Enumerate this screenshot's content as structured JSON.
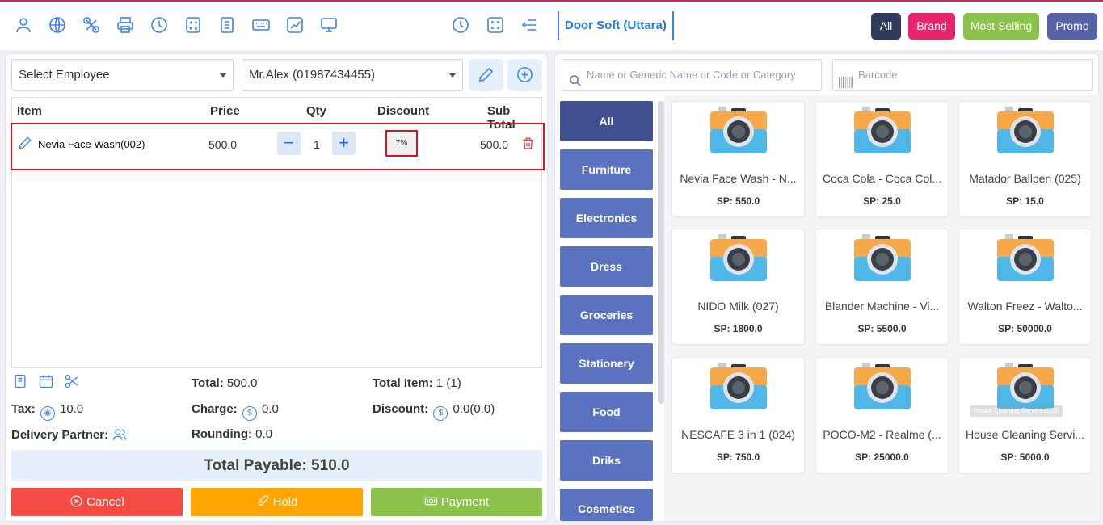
{
  "header": {
    "store_name": "Door Soft (Uttara)",
    "icons": [
      "user-icon",
      "globe-icon",
      "pos-icon",
      "printer-icon",
      "history-icon",
      "calculator-icon",
      "register-icon",
      "keyboard-icon",
      "chart-icon",
      "monitor-icon",
      "clock-icon",
      "fullscreen-icon",
      "menu-collapse-icon"
    ],
    "filters": [
      {
        "label": "All",
        "color": "#2f3a5c"
      },
      {
        "label": "Brand",
        "color": "#e8246a"
      },
      {
        "label": "Most Selling",
        "color": "#8bc34a"
      },
      {
        "label": "Promo",
        "color": "#5663a8"
      }
    ]
  },
  "cart": {
    "employee_select": "Select Employee",
    "customer_select": "Mr.Alex (01987434455)",
    "columns": {
      "item": "Item",
      "price": "Price",
      "qty": "Qty",
      "discount": "Discount",
      "subtotal": "Sub Total"
    },
    "row": {
      "name": "Nevia Face Wash(002)",
      "price": "500.0",
      "qty": "1",
      "discount": "7%",
      "subtotal": "500.0"
    }
  },
  "summary": {
    "total_label": "Total:",
    "total": "500.0",
    "total_item_label": "Total Item:",
    "total_item": "1 (1)",
    "tax_label": "Tax:",
    "tax": "10.0",
    "charge_label": "Charge:",
    "charge": "0.0",
    "discount_label": "Discount:",
    "discount": "0.0(0.0)",
    "delivery_label": "Delivery Partner:",
    "rounding_label": "Rounding:",
    "rounding": "0.0",
    "payable": "Total Payable: 510.0"
  },
  "actions": {
    "cancel": "Cancel",
    "hold": "Hold",
    "payment": "Payment",
    "colors": {
      "cancel": "#f44c43",
      "hold": "#ffa500",
      "payment": "#8bc34a"
    }
  },
  "products_panel": {
    "search_placeholder": "Name or Generic Name or Code or Category",
    "barcode_placeholder": "Barcode",
    "categories": [
      "All",
      "Furniture",
      "Electronics",
      "Dress",
      "Groceries",
      "Stationery",
      "Food",
      "Driks",
      "Cosmetics"
    ],
    "products": [
      {
        "name": "Nevia Face Wash - N...",
        "price": "SP: 550.0"
      },
      {
        "name": "Coca Cola - Coca Col...",
        "price": "SP: 25.0"
      },
      {
        "name": "Matador Ballpen (025)",
        "price": "SP: 15.0"
      },
      {
        "name": "NIDO Milk (027)",
        "price": "SP: 1800.0"
      },
      {
        "name": "Blander Machine - Vi...",
        "price": "SP: 5500.0"
      },
      {
        "name": "Walton Freez - Walto...",
        "price": "SP: 50000.0"
      },
      {
        "name": "NESCAFE 3 in 1 (024)",
        "price": "SP: 750.0"
      },
      {
        "name": "POCO-M2 - Realme (...",
        "price": "SP: 25000.0"
      },
      {
        "name": "House Cleaning Servi...",
        "price": "SP: 5000.0"
      }
    ],
    "tooltip": "House Cleaning Service (003)"
  }
}
